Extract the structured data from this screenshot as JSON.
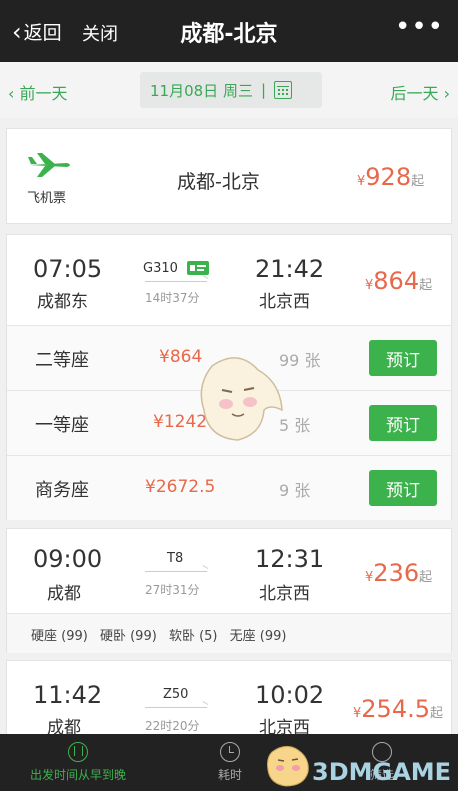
{
  "topbar": {
    "back_label": "返回",
    "close_label": "关闭",
    "title": "成都-北京",
    "more": "•••"
  },
  "datebar": {
    "prev": "前一天",
    "next": "后一天",
    "date": "11月08日 周三",
    "sep": "|"
  },
  "flight": {
    "label": "飞机票",
    "route": "成都-北京",
    "yen": "¥",
    "price": "928",
    "from": "起"
  },
  "trains": [
    {
      "dep_time": "07:05",
      "dep_station": "成都东",
      "code": "G310",
      "duration": "14时37分",
      "arr_time": "21:42",
      "arr_station": "北京西",
      "yen": "¥",
      "price": "864",
      "from": "起"
    },
    {
      "dep_time": "09:00",
      "dep_station": "成都",
      "code": "T8",
      "duration": "27时31分",
      "arr_time": "12:31",
      "arr_station": "北京西",
      "yen": "¥",
      "price": "236",
      "from": "起"
    },
    {
      "dep_time": "11:42",
      "dep_station": "成都",
      "code": "Z50",
      "duration": "22时20分",
      "arr_time": "10:02",
      "arr_station": "北京西",
      "yen": "¥",
      "price": "254.5",
      "from": "起"
    }
  ],
  "seats": [
    {
      "name": "二等座",
      "price": "¥864",
      "count": "99 张",
      "book": "预订"
    },
    {
      "name": "一等座",
      "price": "¥1242",
      "count": "5 张",
      "book": "预订"
    },
    {
      "name": "商务座",
      "price": "¥2672.5",
      "count": "9 张",
      "book": "预订"
    }
  ],
  "t8_seats": [
    "硬座 (99)",
    "硬卧 (99)",
    "软卧 (5)",
    "无座 (99)"
  ],
  "bottom": {
    "sort": "出发时间从早到晚",
    "time": "耗时",
    "filter": "筛选"
  },
  "watermark": "3DMGAME",
  "colors": {
    "accent": "#3cb24d",
    "price": "#e8684a",
    "bar": "#222222"
  }
}
